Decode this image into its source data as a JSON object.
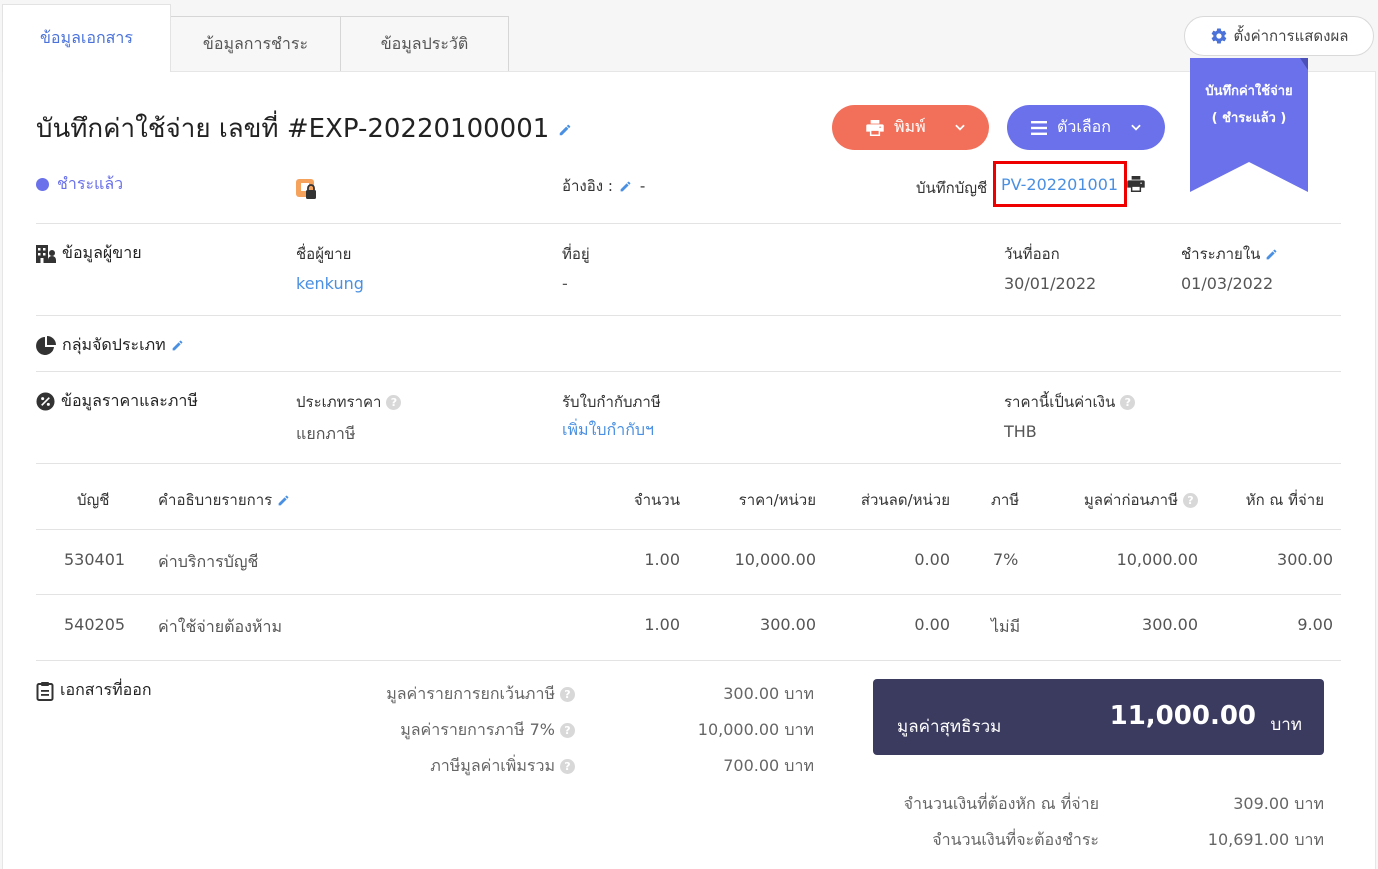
{
  "tabs": [
    "ข้อมูลเอกสาร",
    "ข้อมูลการชำระ",
    "ข้อมูลประวัติ"
  ],
  "settings_label": "ตั้งค่าการแสดงผล",
  "ribbon": {
    "line1": "บันทึกค่าใช้จ่าย",
    "line2": "( ชำระแล้ว )"
  },
  "header": {
    "title": "บันทึกค่าใช้จ่าย เลขที่ #EXP-20220100001",
    "print_label": "พิมพ์",
    "options_label": "ตัวเลือก",
    "status": "ชำระแล้ว",
    "ref_label": "อ้างอิง :",
    "ref_value": "-",
    "account_label": "บันทึกบัญชี",
    "account_value": "PV-202201001"
  },
  "vendor": {
    "section_title": "ข้อมูลผู้ขาย",
    "name_label": "ชื่อผู้ขาย",
    "name_value": "kenkung",
    "address_label": "ที่อยู่",
    "address_value": "-",
    "issue_label": "วันที่ออก",
    "issue_value": "30/01/2022",
    "due_label": "ชำระภายใน",
    "due_value": "01/03/2022"
  },
  "category": {
    "section_title": "กลุ่มจัดประเภท"
  },
  "pricing": {
    "section_title": "ข้อมูลราคาและภาษี",
    "price_type_label": "ประเภทราคา",
    "price_type_value": "แยกภาษี",
    "tax_invoice_label": "รับใบกำกับภาษี",
    "tax_invoice_link": "เพิ่มใบกำกับฯ",
    "currency_label": "ราคานี้เป็นค่าเงิน",
    "currency_value": "THB"
  },
  "table": {
    "headers": [
      "บัญชี",
      "คำอธิบายรายการ",
      "จำนวน",
      "ราคา/หน่วย",
      "ส่วนลด/หน่วย",
      "ภาษี",
      "มูลค่าก่อนภาษี",
      "หัก ณ ที่จ่าย"
    ],
    "rows": [
      {
        "account": "530401",
        "desc": "ค่าบริการบัญชี",
        "qty": "1.00",
        "price": "10,000.00",
        "discount": "0.00",
        "tax": "7%",
        "pretax": "10,000.00",
        "wht": "300.00"
      },
      {
        "account": "540205",
        "desc": "ค่าใช้จ่ายต้องห้าม",
        "qty": "1.00",
        "price": "300.00",
        "discount": "0.00",
        "tax": "ไม่มี",
        "pretax": "300.00",
        "wht": "9.00"
      }
    ]
  },
  "docs": {
    "section_title": "เอกสารที่ออก"
  },
  "summary": {
    "exempt_label": "มูลค่ารายการยกเว้นภาษี",
    "exempt_value": "300.00 บาท",
    "taxable_label": "มูลค่ารายการภาษี 7%",
    "taxable_value": "10,000.00 บาท",
    "vat_label": "ภาษีมูลค่าเพิ่มรวม",
    "vat_value": "700.00 บาท",
    "net_label": "มูลค่าสุทธิรวม",
    "net_value": "11,000.00",
    "net_unit": "บาท",
    "wht_label": "จำนวนเงินที่ต้องหัก ณ ที่จ่าย",
    "wht_value": "309.00 บาท",
    "pay_label": "จำนวนเงินที่จะต้องชำระ",
    "pay_value": "10,691.00 บาท"
  },
  "colors": {
    "accent": "#6a71ea",
    "print": "#f2705a",
    "link": "#4a90e2",
    "total_bg": "#3b3b5f"
  }
}
